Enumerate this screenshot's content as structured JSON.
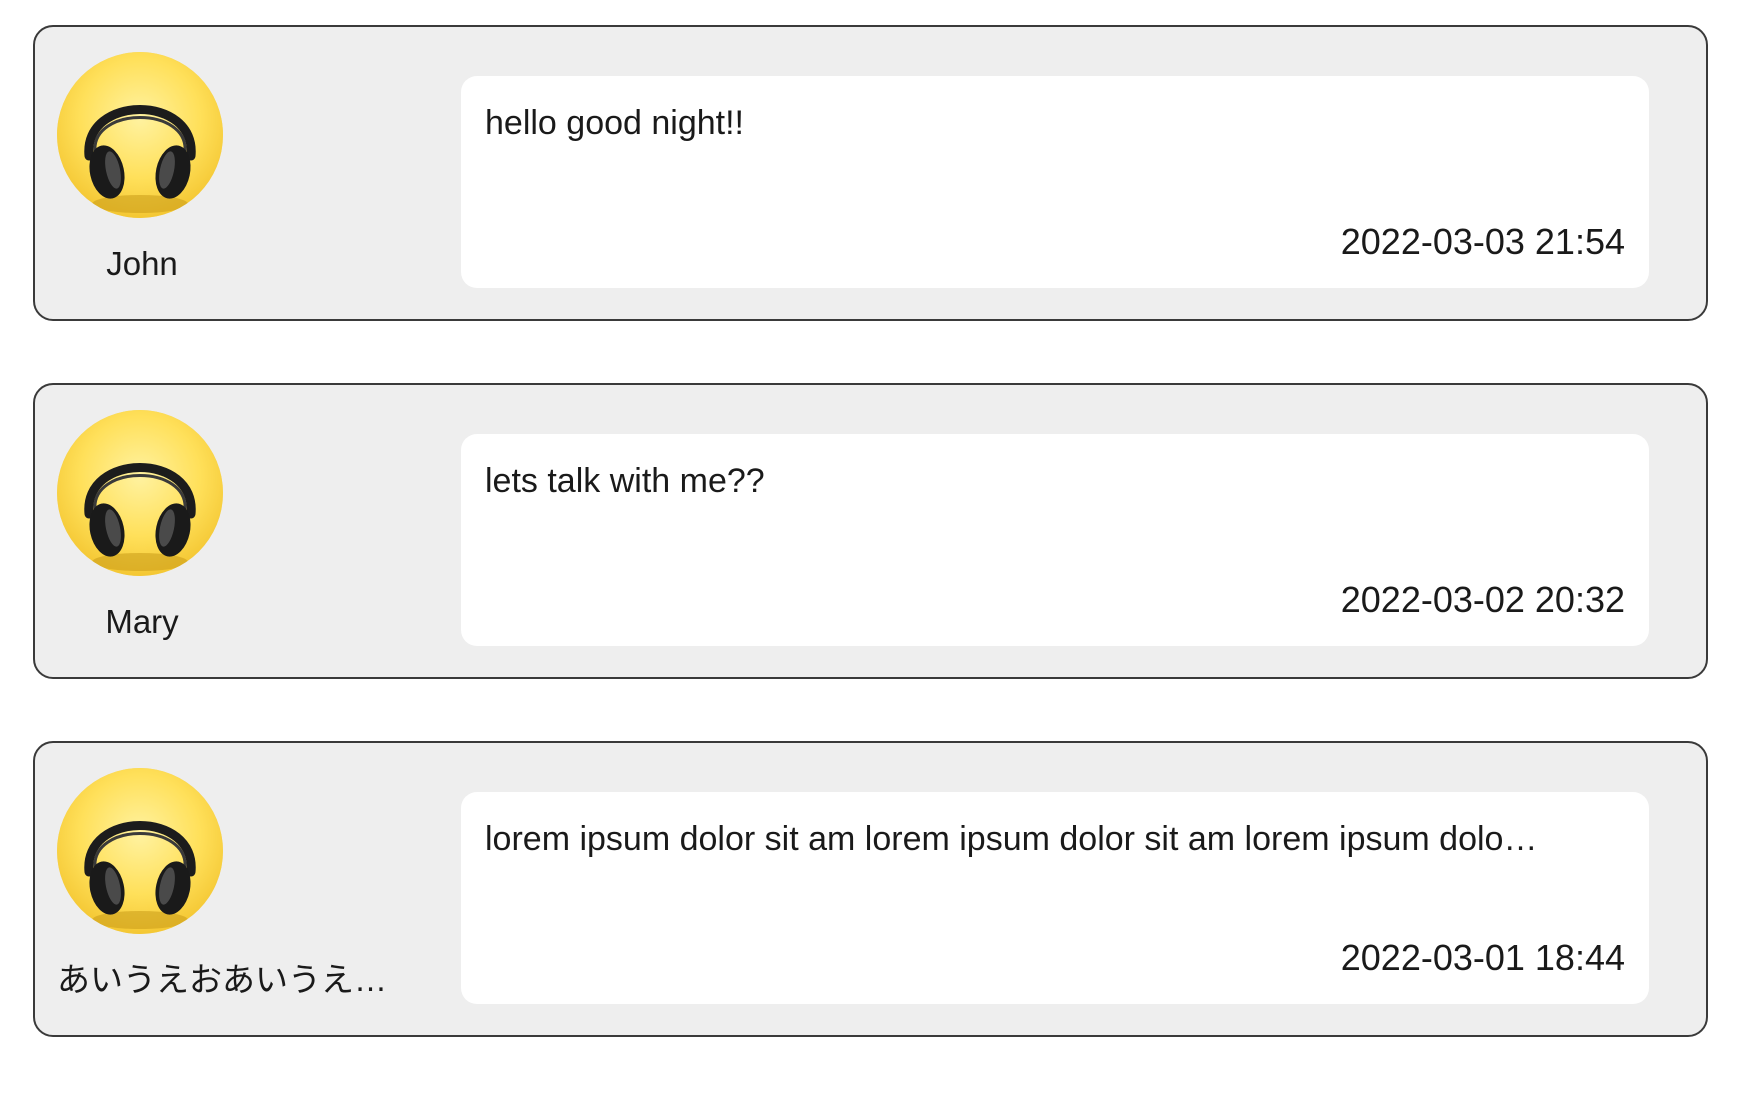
{
  "colors": {
    "card_background": "#eeeeee",
    "card_border": "#3a3a3a",
    "message_background": "#ffffff",
    "avatar_background": "#f7d64a",
    "text": "#1a1a1a"
  },
  "avatar_icon": "headphones-icon",
  "posts": [
    {
      "user_name": "John",
      "message": "hello good night!!",
      "timestamp": "2022-03-03 21:54"
    },
    {
      "user_name": "Mary",
      "message": "lets talk with me??",
      "timestamp": "2022-03-02 20:32"
    },
    {
      "user_name": "あいうえおあいうえお…",
      "message": "lorem ipsum dolor sit am lorem ipsum dolor sit am lorem ipsum dolo…",
      "timestamp": "2022-03-01 18:44"
    }
  ]
}
